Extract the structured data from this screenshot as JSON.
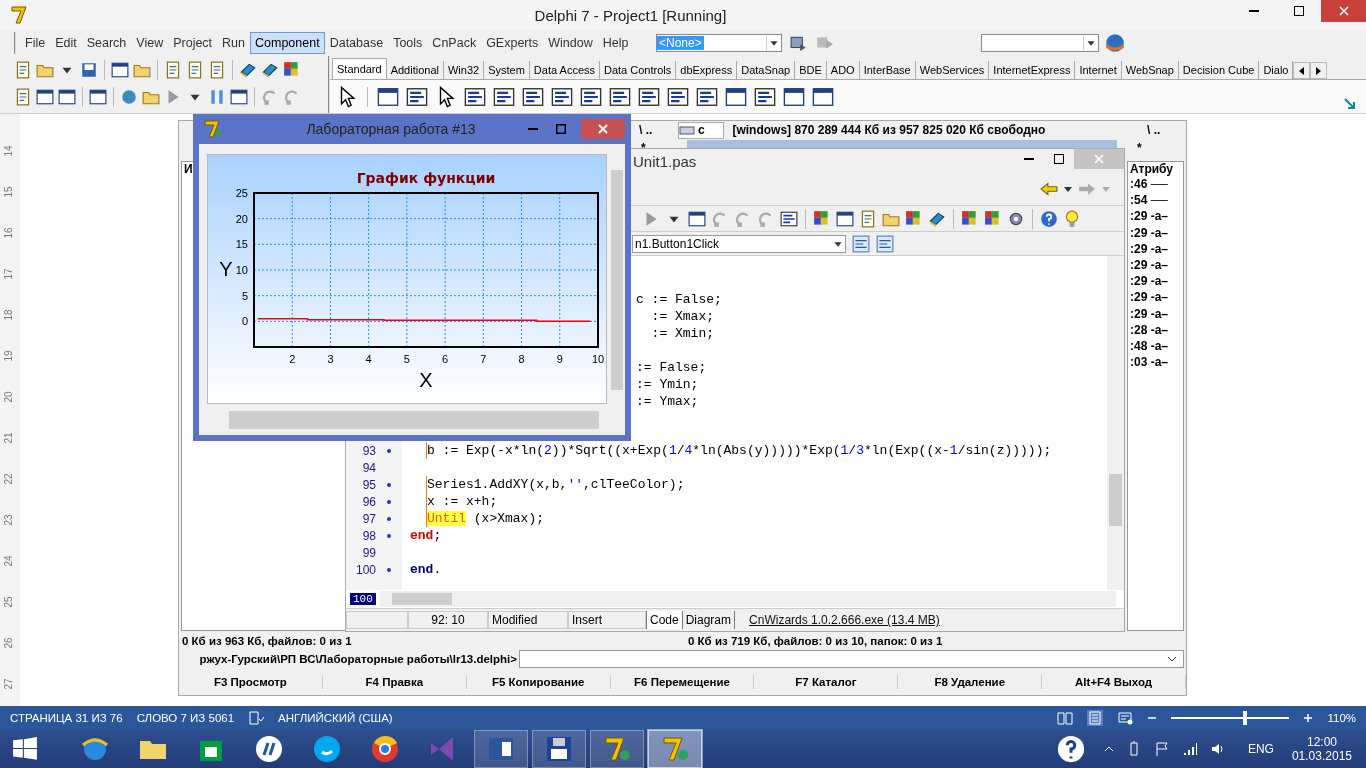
{
  "window": {
    "title": "Delphi 7 - Project1 [Running]"
  },
  "menu": [
    {
      "label": "File",
      "selected": false
    },
    {
      "label": "Edit",
      "selected": false
    },
    {
      "label": "Search",
      "selected": false
    },
    {
      "label": "View",
      "selected": false
    },
    {
      "label": "Project",
      "selected": false
    },
    {
      "label": "Run",
      "selected": false
    },
    {
      "label": "Component",
      "selected": true
    },
    {
      "label": "Database",
      "selected": false
    },
    {
      "label": "Tools",
      "selected": false
    },
    {
      "label": "CnPack",
      "selected": false
    },
    {
      "label": "GExperts",
      "selected": false
    },
    {
      "label": "Window",
      "selected": false
    },
    {
      "label": "Help",
      "selected": false
    }
  ],
  "desktop_combo": {
    "value": "<None>"
  },
  "palette_tabs": [
    {
      "label": "Standard",
      "selected": true
    },
    {
      "label": "Additional",
      "selected": false
    },
    {
      "label": "Win32",
      "selected": false
    },
    {
      "label": "System",
      "selected": false
    },
    {
      "label": "Data Access",
      "selected": false
    },
    {
      "label": "Data Controls",
      "selected": false
    },
    {
      "label": "dbExpress",
      "selected": false
    },
    {
      "label": "DataSnap",
      "selected": false
    },
    {
      "label": "BDE",
      "selected": false
    },
    {
      "label": "ADO",
      "selected": false
    },
    {
      "label": "InterBase",
      "selected": false
    },
    {
      "label": "WebServices",
      "selected": false
    },
    {
      "label": "InternetExpress",
      "selected": false
    },
    {
      "label": "Internet",
      "selected": false
    },
    {
      "label": "WebSnap",
      "selected": false
    },
    {
      "label": "Decision Cube",
      "selected": false
    },
    {
      "label": "Dialo",
      "selected": false
    }
  ],
  "ruler": [
    "14",
    "15",
    "16",
    "17",
    "18",
    "19",
    "20",
    "21",
    "22",
    "23",
    "24",
    "25",
    "26",
    "27"
  ],
  "file_manager": {
    "up_left": "\\  ..",
    "drive": "c",
    "free_space": "[windows]  870 289 444 Кб из 957 825 020 Кб свободно",
    "up_right": "\\  ..",
    "filter_left": "*",
    "filter_right": "*",
    "left_header": "И",
    "right_header": "Атрибу",
    "right_rows": [
      ":46 ──",
      ":54 ──",
      ":29 -a–",
      ":29 -a–",
      ":29 -a–",
      ":29 -a–",
      ":29 -a–",
      ":29 -a–",
      ":29 -a–",
      ":28 -a–",
      ":48 -a–",
      ":03 -a–"
    ],
    "left_status": "0 Кб из 963 Кб, файлов: 0 из 1",
    "right_status": "0 Кб из 719 Кб, файлов: 0 из 10, папок: 0 из 1",
    "command_path": "ржух-Гурский\\РП ВС\\Лабораторные работы\\lr13.delphi>",
    "function_keys": [
      "F3 Просмотр",
      "F4 Правка",
      "F5 Копирование",
      "F6 Перемещение",
      "F7 Каталог",
      "F8 Удаление",
      "Alt+F4 Выход"
    ]
  },
  "editor": {
    "title": "Unit1.pas",
    "procedure": "n1.Button1Click",
    "upper_blocks": [
      [
        "c := False;",
        "  := Xmax;",
        "  := Xmin;"
      ],
      [
        ":= False;",
        ":= Ymin;",
        ":= Ymax;"
      ]
    ],
    "lines": [
      {
        "number": "93",
        "marker": true,
        "kind": "statement",
        "segments": [
          {
            "kind": "plain",
            "text": "b := Exp(-x*ln("
          },
          {
            "kind": "number",
            "text": "2"
          },
          {
            "kind": "plain",
            "text": "))*Sqrt((x+Exp("
          },
          {
            "kind": "number",
            "text": "1"
          },
          {
            "kind": "plain",
            "text": "/"
          },
          {
            "kind": "number",
            "text": "4"
          },
          {
            "kind": "plain",
            "text": "*ln(Abs(y)))))*Exp("
          },
          {
            "kind": "number",
            "text": "1"
          },
          {
            "kind": "plain",
            "text": "/"
          },
          {
            "kind": "number",
            "text": "3"
          },
          {
            "kind": "plain",
            "text": "*ln(Exp((x-"
          },
          {
            "kind": "number",
            "text": "1"
          },
          {
            "kind": "plain",
            "text": "/sin(z)))));"
          }
        ]
      },
      {
        "number": "94",
        "marker": false
      },
      {
        "number": "95",
        "marker": true,
        "kind": "statement",
        "segments": [
          {
            "kind": "plain",
            "text": "Series1.AddXY(x,b,"
          },
          {
            "kind": "string",
            "text": "''"
          },
          {
            "kind": "plain",
            "text": ",clTeeColor);"
          }
        ]
      },
      {
        "number": "96",
        "marker": true,
        "kind": "statement",
        "segments": [
          {
            "kind": "plain",
            "text": "x := x+h;"
          }
        ]
      },
      {
        "number": "97",
        "marker": true,
        "kind": "statement",
        "segments": [
          {
            "kind": "match",
            "text": "Until"
          },
          {
            "kind": "plain",
            "text": " (x>Xmax);"
          }
        ]
      },
      {
        "number": "98",
        "marker": true,
        "kind": "block_end",
        "segments": [
          {
            "kind": "bracket",
            "text": "end"
          },
          {
            "kind": "plain",
            "text": ";"
          }
        ]
      },
      {
        "number": "99",
        "marker": false
      },
      {
        "number": "100",
        "marker": true,
        "kind": "block_end",
        "segments": [
          {
            "kind": "keyword",
            "text": "end"
          },
          {
            "kind": "plain",
            "text": "."
          }
        ]
      }
    ],
    "current_line": "100",
    "position": "92:  10",
    "modified": "Modified",
    "mode": "Insert",
    "tabs": [
      {
        "label": "Code",
        "selected": true
      },
      {
        "label": "Diagram",
        "selected": false
      }
    ],
    "plugin": "CnWizards  1.0.2.666.exe (13.4 MB)"
  },
  "form": {
    "title": "Лабораторная работа #13",
    "chart_data": {
      "type": "line",
      "title": "График функции",
      "xlabel": "X",
      "ylabel": "Y",
      "grid": true,
      "x": [
        1.1,
        2.4,
        2.4,
        4.4,
        4.4,
        8.4,
        8.4,
        9.8
      ],
      "series": [
        {
          "color": "#ff0000",
          "values": [
            0.5,
            0.5,
            0.3,
            0.3,
            0.2,
            0.2,
            0,
            0
          ]
        }
      ],
      "xlim": [
        1,
        10
      ],
      "ylim": [
        -5,
        25
      ],
      "xticks": [
        2,
        3,
        4,
        5,
        6,
        7,
        8,
        9,
        10
      ],
      "yticks": [
        0,
        5,
        10,
        15,
        20,
        25
      ]
    }
  },
  "word_status": {
    "page": "СТРАНИЦА 31 ИЗ 76",
    "words": "СЛОВО 7 ИЗ 5061",
    "language": "АНГЛИЙСКИЙ (США)",
    "zoom": "110%",
    "zoom_slider": {
      "level": 0.62
    }
  },
  "taskbar": {
    "apps": [
      {
        "kind": "browser",
        "running": false,
        "selected": false
      },
      {
        "kind": "folder",
        "running": false,
        "selected": false
      },
      {
        "kind": "store",
        "running": false,
        "selected": false
      },
      {
        "kind": "printer",
        "running": false,
        "selected": false
      },
      {
        "kind": "chat",
        "running": false,
        "selected": false
      },
      {
        "kind": "globe",
        "running": false,
        "selected": false
      },
      {
        "kind": "studio",
        "running": false,
        "selected": false
      },
      {
        "kind": "word",
        "running": true,
        "selected": false
      },
      {
        "kind": "disk",
        "running": true,
        "selected": false
      },
      {
        "kind": "delphi",
        "running": true,
        "selected": false
      },
      {
        "kind": "delphi",
        "running": true,
        "selected": true
      }
    ],
    "language": "ENG",
    "time": "12:00",
    "date": "01.03.2015"
  }
}
